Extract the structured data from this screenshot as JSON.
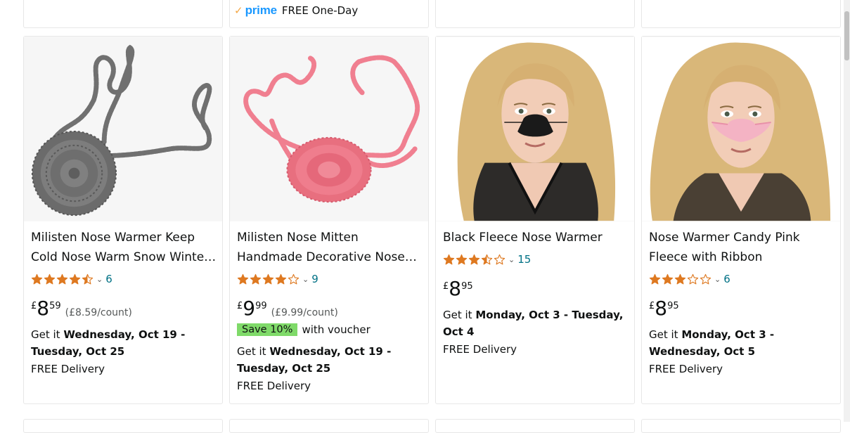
{
  "top_row": {
    "prime": {
      "check": "✓",
      "word": "prime",
      "text": "FREE One-Day"
    }
  },
  "products": [
    {
      "title": "Milisten Nose Warmer Keep Cold Nose Warm Snow Winter Crochet Nose Cover",
      "rating": 4.5,
      "count": "6",
      "price_currency": "£",
      "price_whole": "8",
      "price_fraction": "59",
      "unit_price": "(£8.59/count)",
      "delivery_prefix": "Get it ",
      "delivery_date": "Wednesday, Oct 19 - Tuesday, Oct 25",
      "free": "FREE Delivery",
      "image": "grey-crochet-nose-warmer"
    },
    {
      "title": "Milisten Nose Mitten Handmade Decorative Nose Warmer Knitted Cover",
      "rating": 4.0,
      "count": "9",
      "price_currency": "£",
      "price_whole": "9",
      "price_fraction": "99",
      "unit_price": "(£9.99/count)",
      "save_badge": "Save 10%",
      "save_text": "with voucher",
      "delivery_prefix": "Get it ",
      "delivery_date": "Wednesday, Oct 19 - Tuesday, Oct 25",
      "free": "FREE Delivery",
      "image": "pink-crochet-nose-warmer"
    },
    {
      "title": "Black Fleece Nose Warmer",
      "rating": 3.5,
      "count": "15",
      "price_currency": "£",
      "price_whole": "8",
      "price_fraction": "95",
      "delivery_prefix": "Get it ",
      "delivery_date": "Monday, Oct 3 - Tuesday, Oct 4",
      "free": "FREE Delivery",
      "image": "woman-black-nose-warmer"
    },
    {
      "title": "Nose Warmer Candy Pink Fleece with Ribbon",
      "rating": 3.0,
      "count": "6",
      "price_currency": "£",
      "price_whole": "8",
      "price_fraction": "95",
      "delivery_prefix": "Get it ",
      "delivery_date": "Monday, Oct 3 - Wednesday, Oct 5",
      "free": "FREE Delivery",
      "image": "woman-pink-nose-warmer"
    }
  ],
  "colors": {
    "star": "#de7921",
    "link": "#007185",
    "prime": "#1a98ff",
    "save": "#7fda69"
  }
}
